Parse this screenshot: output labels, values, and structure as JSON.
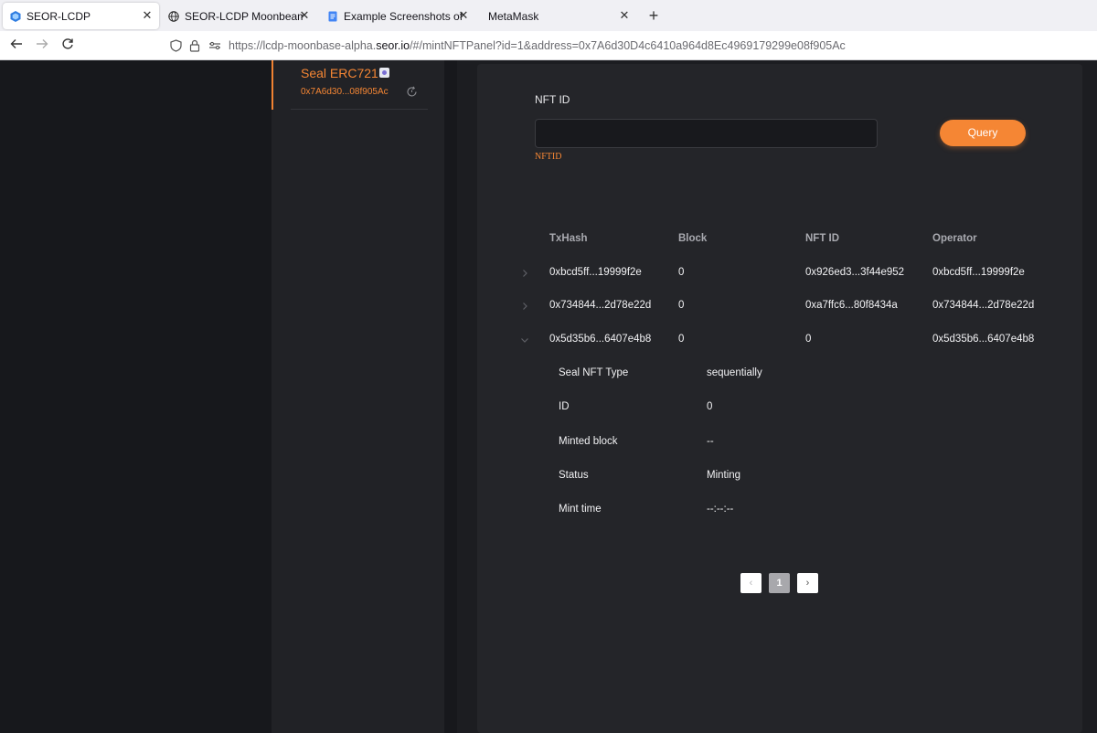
{
  "browser": {
    "tabs": [
      {
        "label": "SEOR-LCDP",
        "icon": "seor-logo-icon",
        "active": true
      },
      {
        "label": "SEOR-LCDP Moonbeam Testnet",
        "icon": "globe-icon",
        "active": false
      },
      {
        "label": "Example Screenshots of Moonbe",
        "icon": "document-icon",
        "active": false
      },
      {
        "label": "MetaMask",
        "icon": "",
        "active": false
      }
    ],
    "new_tab_label": "+",
    "close_label": "✕",
    "url_prefix": "https://lcdp-moonbase-alpha.",
    "url_domain": "seor.io",
    "url_suffix": "/#/mintNFTPanel?id=1&address=0x7A6d30D4c6410a964d8Ec4969179299e08f905Ac"
  },
  "sidebar": {
    "contract_name": "Seal ERC721",
    "contract_address": "0x7A6d30...08f905Ac"
  },
  "query": {
    "label": "NFT ID",
    "input_value": "",
    "error_text": "NFTID",
    "button_label": "Query"
  },
  "table": {
    "headers": [
      "TxHash",
      "Block",
      "NFT ID",
      "Operator"
    ],
    "rows": [
      {
        "txhash": "0xbcd5ff...19999f2e",
        "block": "0",
        "nft_id": "0x926ed3...3f44e952",
        "operator": "0xbcd5ff...19999f2e",
        "expanded": false
      },
      {
        "txhash": "0x734844...2d78e22d",
        "block": "0",
        "nft_id": "0xa7ffc6...80f8434a",
        "operator": "0x734844...2d78e22d",
        "expanded": false
      },
      {
        "txhash": "0x5d35b6...6407e4b8",
        "block": "0",
        "nft_id": "0",
        "operator": "0x5d35b6...6407e4b8",
        "expanded": true
      }
    ],
    "details": [
      {
        "label": "Seal NFT Type",
        "value": "sequentially"
      },
      {
        "label": "ID",
        "value": "0"
      },
      {
        "label": "Minted block",
        "value": "--"
      },
      {
        "label": "Status",
        "value": "Minting"
      },
      {
        "label": "Mint time",
        "value": "--:--:--"
      }
    ]
  },
  "pagination": {
    "prev": "‹",
    "current": "1",
    "next": "›"
  }
}
